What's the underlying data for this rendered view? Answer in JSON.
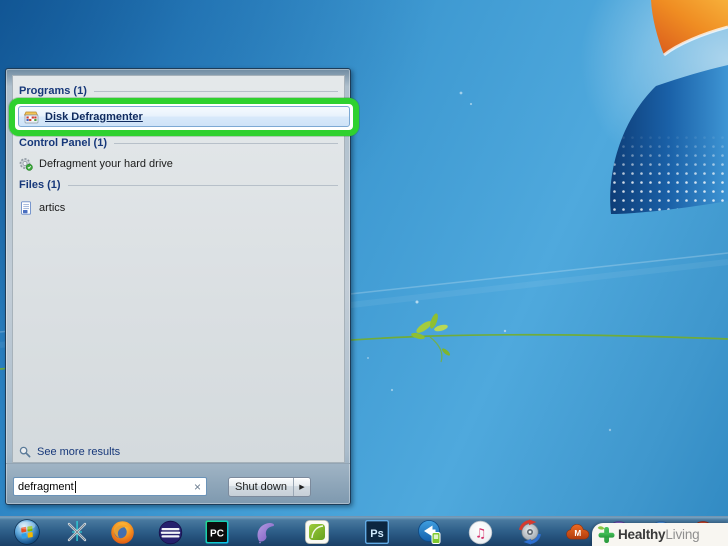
{
  "start_menu": {
    "sections": {
      "programs": {
        "header": "Programs (1)"
      },
      "control_panel": {
        "header": "Control Panel (1)"
      },
      "files": {
        "header": "Files (1)"
      }
    },
    "items": {
      "disk_defragmenter": {
        "label": "Disk Defragmenter",
        "icon": "disk-defragmenter-icon",
        "highlighted": true
      },
      "defragment_drive": {
        "label": "Defragment your hard drive",
        "icon": "control-panel-gear-icon"
      },
      "artics": {
        "label": "artics",
        "icon": "document-icon"
      }
    },
    "see_more_results": "See more results",
    "search": {
      "value": "defragment",
      "clear_icon": "×"
    },
    "shutdown": {
      "label": "Shut down",
      "arrow_icon": "▶"
    }
  },
  "taskbar": {
    "icons": [
      "windows-start",
      "crossed-tools",
      "firefox",
      "eclipse",
      "pycharm",
      "purple-dolphin",
      "green-office",
      "photoshop",
      "video-converter",
      "itunes",
      "disc-ripper",
      "cloud-m"
    ],
    "pycharm_label": "PC",
    "photoshop_label": "Ps",
    "cloud_label": "M"
  },
  "watermark": {
    "brand_bold": "Healthy",
    "brand_light": "Living"
  },
  "colors": {
    "highlight_green": "#2fd12f",
    "selection_border": "#7da9d4",
    "header_text": "#17387a",
    "desktop_blue": "#3f9ad2",
    "taskbar_blue": "#30618b",
    "watermark_green": "#35ab4a"
  }
}
